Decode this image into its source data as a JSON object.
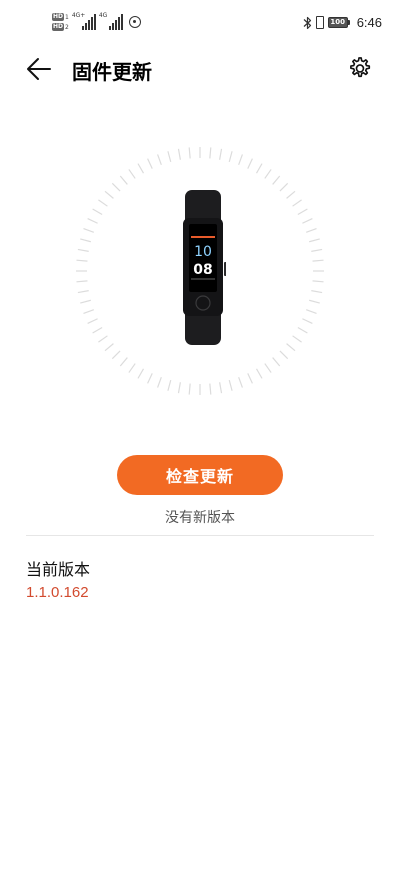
{
  "status_bar": {
    "hd_label": "HD",
    "sim1_index": "1",
    "sim2_index": "2",
    "sim1_network": "4G+",
    "sim2_network": "4G",
    "battery": "100",
    "time": "6:46"
  },
  "header": {
    "title": "固件更新",
    "back_icon": "arrow-left-icon",
    "settings_icon": "gear-icon"
  },
  "device": {
    "screen_time": "10\n08"
  },
  "update": {
    "button_label": "检查更新",
    "status_text": "没有新版本",
    "accent_color": "#f26a23"
  },
  "version": {
    "label": "当前版本",
    "value": "1.1.0.162",
    "value_color": "#d24a2e"
  }
}
